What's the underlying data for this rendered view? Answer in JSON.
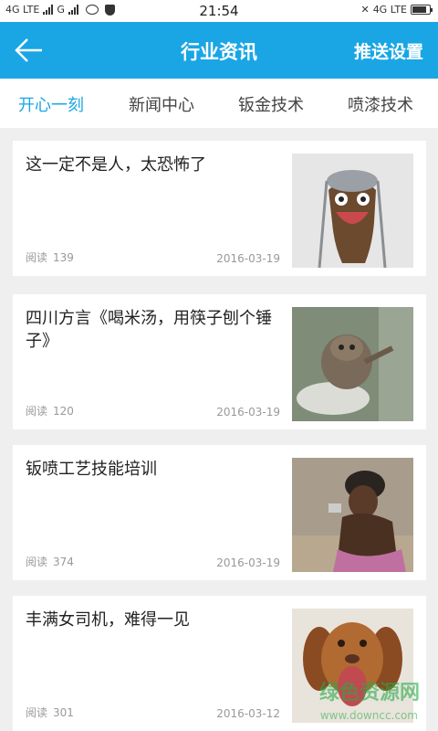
{
  "status_bar": {
    "left_text": "4G LTE",
    "carrier2": "G",
    "time": "21:54",
    "right_text": "4G LTE",
    "battery_level": 0.85
  },
  "app_bar": {
    "title": "行业资讯",
    "action_label": "推送设置",
    "back_icon": "arrow-left-icon"
  },
  "tabs": [
    {
      "label": "开心一刻",
      "active": true
    },
    {
      "label": "新闻中心",
      "active": false
    },
    {
      "label": "钣金技术",
      "active": false
    },
    {
      "label": "喷漆技术",
      "active": false
    }
  ],
  "articles": [
    {
      "title": "这一定不是人，太恐怖了",
      "read_label": "阅读",
      "read_count": "139",
      "date": "2016-03-19",
      "image": "cork-face-image"
    },
    {
      "title": "四川方言《喝米汤，用筷子刨个锤子》",
      "read_label": "阅读",
      "read_count": "120",
      "date": "2016-03-19",
      "image": "cat-on-toilet-image"
    },
    {
      "title": "钣喷工艺技能培训",
      "read_label": "阅读",
      "read_count": "374",
      "date": "2016-03-19",
      "image": "man-with-mirror-image"
    },
    {
      "title": "丰满女司机，难得一见",
      "read_label": "阅读",
      "read_count": "301",
      "date": "2016-03-12",
      "image": "yawning-dog-image"
    }
  ],
  "colors": {
    "accent": "#1aa6e4",
    "background": "#efefef"
  },
  "watermark": {
    "text": "绿色资源网",
    "sub": "www.downcc.com"
  }
}
